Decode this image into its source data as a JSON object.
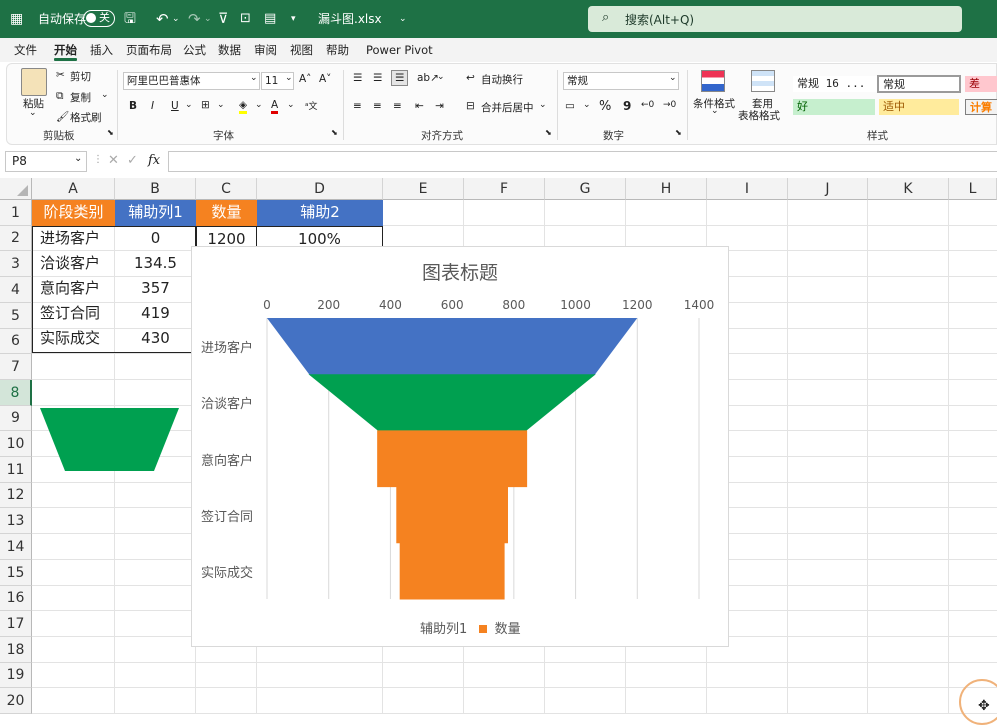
{
  "titlebar": {
    "autosave_label": "自动保存",
    "autosave_state": "关",
    "filename": "漏斗图.xlsx",
    "search_label": "搜索(Alt+Q)"
  },
  "menu": {
    "items": [
      "文件",
      "开始",
      "插入",
      "页面布局",
      "公式",
      "数据",
      "审阅",
      "视图",
      "帮助",
      "Power Pivot"
    ],
    "active": "开始"
  },
  "ribbon": {
    "clipboard": {
      "paste": "粘贴",
      "cut": "剪切",
      "copy": "复制",
      "format_painter": "格式刷",
      "group": "剪贴板"
    },
    "font": {
      "name": "阿里巴巴普惠体",
      "size": "11",
      "bold": "B",
      "italic": "I",
      "underline": "U",
      "group": "字体"
    },
    "alignment": {
      "wrap": "自动换行",
      "merge": "合并后居中",
      "group": "对齐方式"
    },
    "number": {
      "format": "常规",
      "percent": "%",
      "comma": "9",
      "group": "数字"
    },
    "styles": {
      "conditional": "条件格式",
      "table_format_1": "套用",
      "table_format_2": "表格格式",
      "cells": [
        "常规 16 ...",
        "常规",
        "差",
        "好",
        "适中",
        "计算"
      ],
      "group": "样式"
    }
  },
  "formula_bar": {
    "name_box": "P8",
    "fx": "fx",
    "content": ""
  },
  "columns": [
    "A",
    "B",
    "C",
    "D",
    "E",
    "F",
    "G",
    "H",
    "I",
    "J",
    "K",
    "L"
  ],
  "rows": [
    "1",
    "2",
    "3",
    "4",
    "5",
    "6",
    "7",
    "8",
    "9",
    "10",
    "11",
    "12",
    "13",
    "14",
    "15",
    "16",
    "17",
    "18",
    "19",
    "20"
  ],
  "selected_row": "8",
  "table": {
    "headers": [
      "阶段类别",
      "辅助列1",
      "数量",
      "辅助2"
    ],
    "rows": [
      [
        "进场客户",
        "0",
        "1200",
        "100%"
      ],
      [
        "洽谈客户",
        "134.5",
        "",
        ""
      ],
      [
        "意向客户",
        "357",
        "",
        ""
      ],
      [
        "签订合同",
        "419",
        "",
        ""
      ],
      [
        "实际成交",
        "430",
        "",
        ""
      ]
    ]
  },
  "colors": {
    "excel_green": "#1e7145",
    "orange": "#f58220",
    "blue": "#4472c4",
    "green": "#00a050"
  },
  "chart_data": {
    "type": "bar",
    "title": "图表标题",
    "categories": [
      "进场客户",
      "洽谈客户",
      "意向客户",
      "签订合同",
      "实际成交"
    ],
    "series": [
      {
        "name": "辅助列1",
        "values": [
          0,
          134.5,
          357,
          419,
          430
        ]
      },
      {
        "name": "数量",
        "values": [
          1200,
          931,
          486,
          362,
          340
        ]
      }
    ],
    "xlim": [
      0,
      1400
    ],
    "ticks": [
      "0",
      "200",
      "400",
      "600",
      "800",
      "1000",
      "1200",
      "1400"
    ],
    "legend_position": "bottom",
    "legend": [
      "辅助列1",
      "数量"
    ],
    "grid": true
  }
}
